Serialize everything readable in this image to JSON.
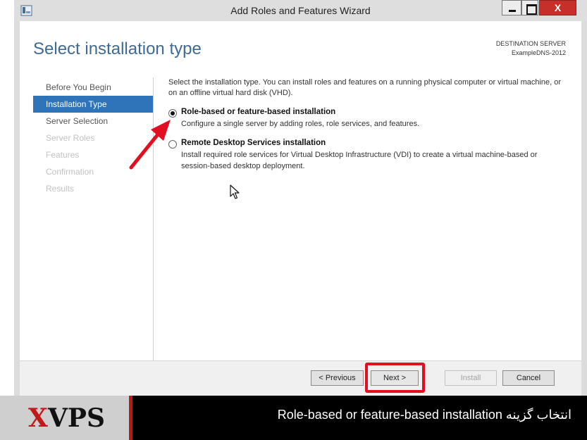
{
  "window": {
    "title": "Add Roles and Features Wizard",
    "close_glyph": "X"
  },
  "header": {
    "title": "Select installation type",
    "destination_label": "DESTINATION SERVER",
    "destination_server": "ExampleDNS-2012"
  },
  "nav": {
    "items": [
      {
        "label": "Before You Begin",
        "state": "normal"
      },
      {
        "label": "Installation Type",
        "state": "active"
      },
      {
        "label": "Server Selection",
        "state": "normal"
      },
      {
        "label": "Server Roles",
        "state": "disabled"
      },
      {
        "label": "Features",
        "state": "disabled"
      },
      {
        "label": "Confirmation",
        "state": "disabled"
      },
      {
        "label": "Results",
        "state": "disabled"
      }
    ]
  },
  "content": {
    "intro": "Select the installation type. You can install roles and features on a running physical computer or virtual machine, or on an offline virtual hard disk (VHD).",
    "options": [
      {
        "title": "Role-based or feature-based installation",
        "description": "Configure a single server by adding roles, role services, and features.",
        "selected": true
      },
      {
        "title": "Remote Desktop Services installation",
        "description": "Install required role services for Virtual Desktop Infrastructure (VDI) to create a virtual machine-based or session-based desktop deployment.",
        "selected": false
      }
    ]
  },
  "footer": {
    "previous_label": "< Previous",
    "next_label": "Next >",
    "install_label": "Install",
    "cancel_label": "Cancel"
  },
  "caption": {
    "logo_x": "X",
    "logo_rest": "VPS",
    "text": "انتخاب گزینه Role-based or feature-based installation"
  },
  "colors": {
    "accent_blue": "#2f73b9",
    "header_blue": "#3f6a95",
    "highlight_red": "#e01020",
    "close_red": "#c7302a"
  }
}
